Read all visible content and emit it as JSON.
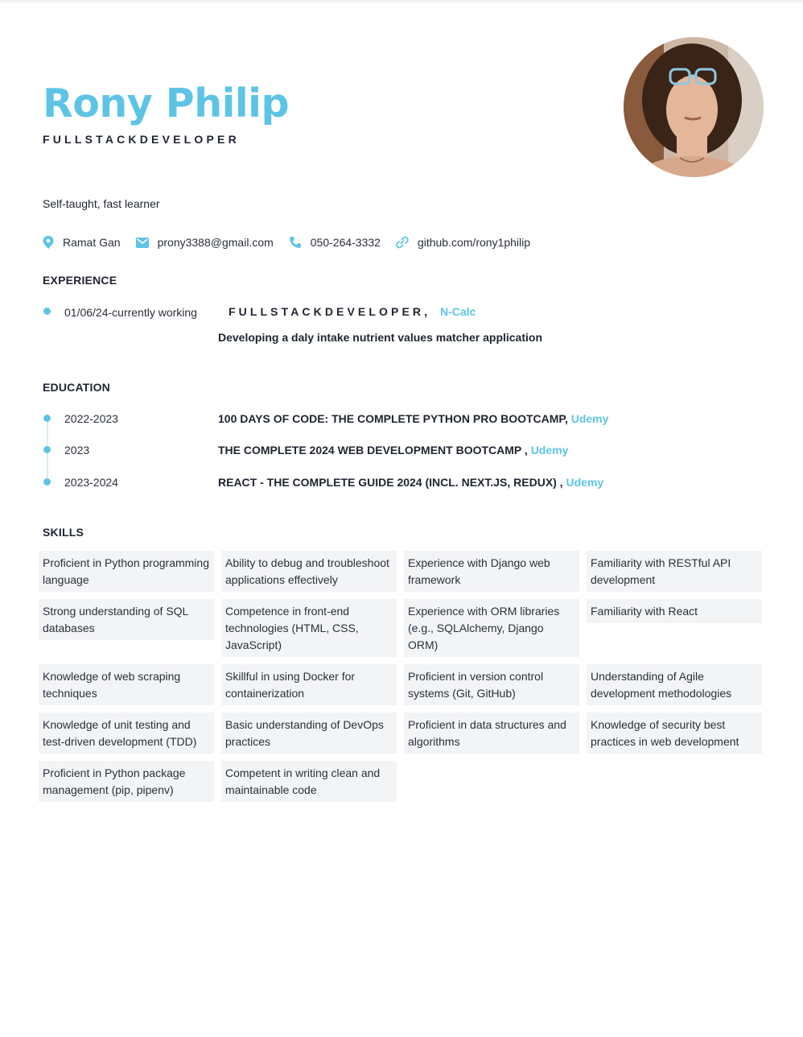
{
  "header": {
    "name": "Rony Philip",
    "role": "FULLSTACKDEVELOPER",
    "summary": "Self-taught, fast learner",
    "photo_alt": "profile photo"
  },
  "contacts": [
    {
      "icon": "location-pin-icon",
      "text": "Ramat Gan"
    },
    {
      "icon": "envelope-icon",
      "text": "prony3388@gmail.com"
    },
    {
      "icon": "phone-icon",
      "text": "050-264-3332"
    },
    {
      "icon": "link-icon",
      "text": "github.com/rony1philip"
    }
  ],
  "experience": {
    "title": "EXPERIENCE",
    "items": [
      {
        "date": "01/06/24-currently working",
        "position": "FULLSTACKDEVELOPER,",
        "company": "N-Calc",
        "description": "Developing a daly intake nutrient values matcher application"
      }
    ]
  },
  "education": {
    "title": "EDUCATION",
    "items": [
      {
        "date": "2022-2023",
        "course": "100 DAYS OF CODE: THE COMPLETE PYTHON PRO BOOTCAMP,",
        "provider": "Udemy"
      },
      {
        "date": "2023",
        "course": "THE COMPLETE 2024 WEB DEVELOPMENT BOOTCAMP ,",
        "provider": "Udemy"
      },
      {
        "date": "2023-2024",
        "course": "REACT - THE COMPLETE GUIDE 2024 (INCL. NEXT.JS, REDUX) ,",
        "provider": "Udemy"
      }
    ]
  },
  "skills": {
    "title": "SKILLS",
    "items": [
      "Proficient in Python programming language",
      "Ability to debug and troubleshoot applications effectively",
      "Experience with Django web framework",
      "Familiarity with RESTful API development",
      "Strong understanding of SQL databases",
      "Competence in front-end technologies (HTML, CSS, JavaScript)",
      "Experience with ORM libraries (e.g., SQLAlchemy, Django ORM)",
      "Familiarity with React",
      "Knowledge of web scraping techniques",
      "Skillful in using Docker for containerization",
      "Proficient in version control systems (Git, GitHub)",
      "Understanding of Agile development methodologies",
      "Knowledge of unit testing and test-driven development (TDD)",
      "Basic understanding of DevOps practices",
      "Proficient in data structures and algorithms",
      "Knowledge of security best practices in web development",
      "Proficient in Python package management (pip, pipenv)",
      "Competent in writing clean and maintainable code"
    ]
  },
  "colors": {
    "accent": "#5ec4e6",
    "text": "#1f2430",
    "skill_bg": "#f3f4f6"
  }
}
